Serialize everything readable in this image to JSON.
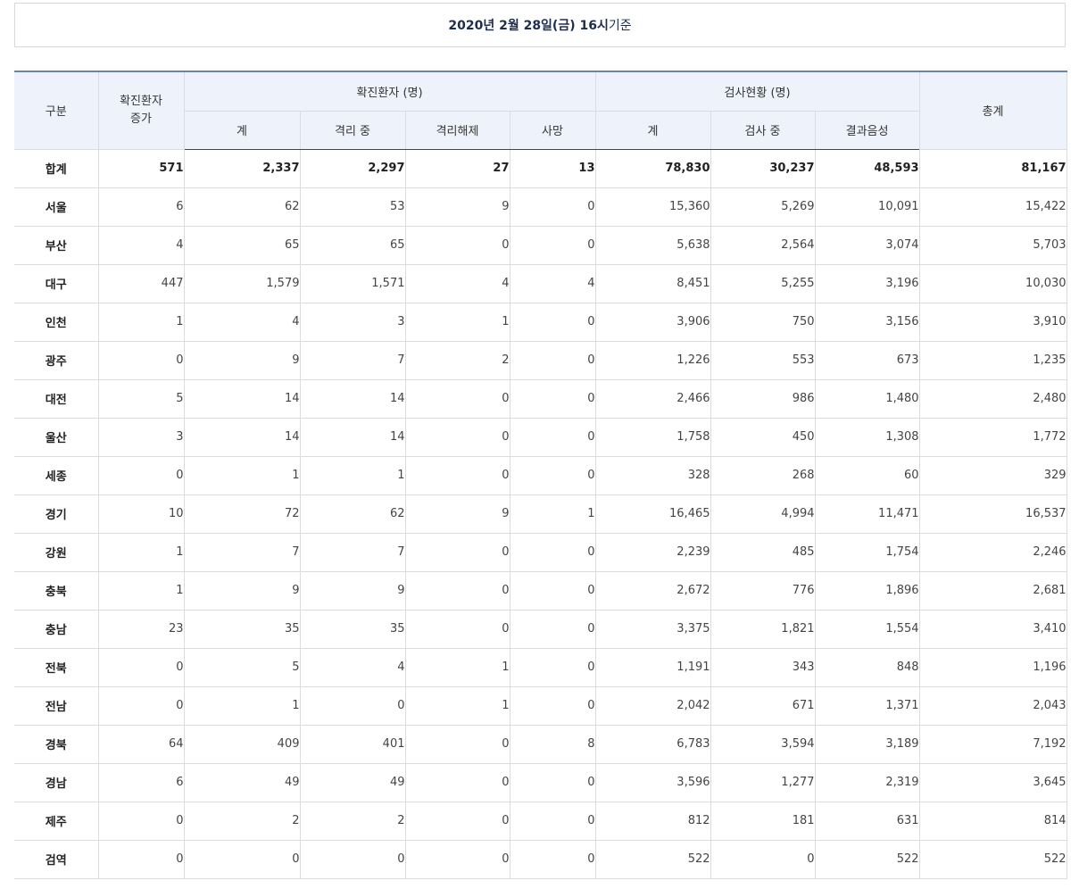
{
  "header": {
    "date_bold": "2020년 2월 28일(금) 16시",
    "date_suffix": "기준"
  },
  "table": {
    "headers": {
      "region": "구분",
      "increase": "확진환자\n증가",
      "confirmed_group": "확진환자 (명)",
      "test_group": "검사현황 (명)",
      "grand_total": "총계",
      "confirmed_total": "계",
      "isolating": "격리 중",
      "released": "격리해제",
      "deaths": "사망",
      "test_total": "계",
      "testing": "검사 중",
      "negative": "결과음성"
    },
    "total_row": [
      "합계",
      "571",
      "2,337",
      "2,297",
      "27",
      "13",
      "78,830",
      "30,237",
      "48,593",
      "81,167"
    ],
    "rows": [
      [
        "서울",
        "6",
        "62",
        "53",
        "9",
        "0",
        "15,360",
        "5,269",
        "10,091",
        "15,422"
      ],
      [
        "부산",
        "4",
        "65",
        "65",
        "0",
        "0",
        "5,638",
        "2,564",
        "3,074",
        "5,703"
      ],
      [
        "대구",
        "447",
        "1,579",
        "1,571",
        "4",
        "4",
        "8,451",
        "5,255",
        "3,196",
        "10,030"
      ],
      [
        "인천",
        "1",
        "4",
        "3",
        "1",
        "0",
        "3,906",
        "750",
        "3,156",
        "3,910"
      ],
      [
        "광주",
        "0",
        "9",
        "7",
        "2",
        "0",
        "1,226",
        "553",
        "673",
        "1,235"
      ],
      [
        "대전",
        "5",
        "14",
        "14",
        "0",
        "0",
        "2,466",
        "986",
        "1,480",
        "2,480"
      ],
      [
        "울산",
        "3",
        "14",
        "14",
        "0",
        "0",
        "1,758",
        "450",
        "1,308",
        "1,772"
      ],
      [
        "세종",
        "0",
        "1",
        "1",
        "0",
        "0",
        "328",
        "268",
        "60",
        "329"
      ],
      [
        "경기",
        "10",
        "72",
        "62",
        "9",
        "1",
        "16,465",
        "4,994",
        "11,471",
        "16,537"
      ],
      [
        "강원",
        "1",
        "7",
        "7",
        "0",
        "0",
        "2,239",
        "485",
        "1,754",
        "2,246"
      ],
      [
        "충북",
        "1",
        "9",
        "9",
        "0",
        "0",
        "2,672",
        "776",
        "1,896",
        "2,681"
      ],
      [
        "충남",
        "23",
        "35",
        "35",
        "0",
        "0",
        "3,375",
        "1,821",
        "1,554",
        "3,410"
      ],
      [
        "전북",
        "0",
        "5",
        "4",
        "1",
        "0",
        "1,191",
        "343",
        "848",
        "1,196"
      ],
      [
        "전남",
        "0",
        "1",
        "0",
        "1",
        "0",
        "2,042",
        "671",
        "1,371",
        "2,043"
      ],
      [
        "경북",
        "64",
        "409",
        "401",
        "0",
        "8",
        "6,783",
        "3,594",
        "3,189",
        "7,192"
      ],
      [
        "경남",
        "6",
        "49",
        "49",
        "0",
        "0",
        "3,596",
        "1,277",
        "2,319",
        "3,645"
      ],
      [
        "제주",
        "0",
        "2",
        "2",
        "0",
        "0",
        "812",
        "181",
        "631",
        "814"
      ],
      [
        "검역",
        "0",
        "0",
        "0",
        "0",
        "0",
        "522",
        "0",
        "522",
        "522"
      ]
    ]
  }
}
